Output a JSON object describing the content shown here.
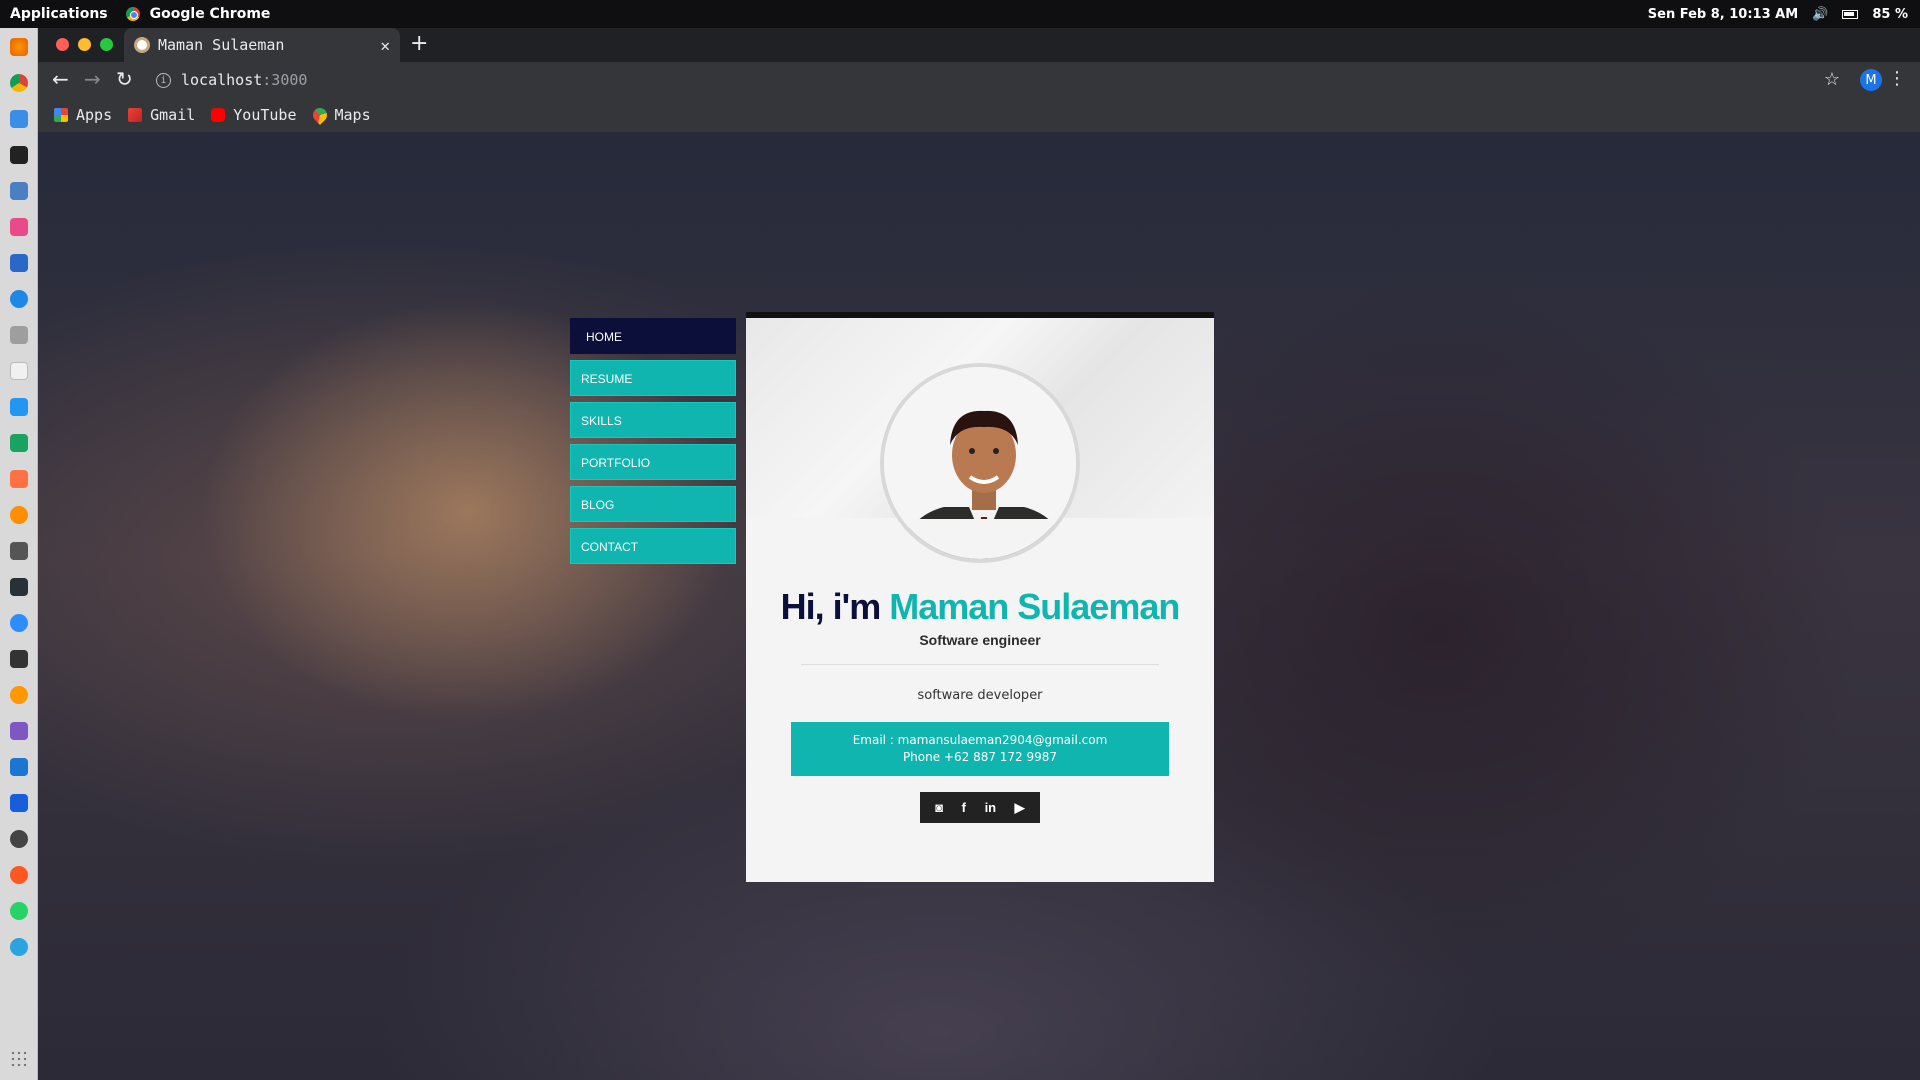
{
  "system_bar": {
    "applications": "Applications",
    "app_name": "Google Chrome",
    "datetime": "Sen Feb  8, 10:13 AM",
    "battery": "85 %"
  },
  "browser": {
    "tab_title": "Maman Sulaeman",
    "url_host": "localhost",
    "url_port": ":3000",
    "profile_initial": "M",
    "bookmarks": [
      {
        "label": "Apps",
        "icon": "apps-grid-icon"
      },
      {
        "label": "Gmail",
        "icon": "gmail-icon"
      },
      {
        "label": "YouTube",
        "icon": "youtube-icon"
      },
      {
        "label": "Maps",
        "icon": "maps-icon"
      }
    ]
  },
  "site": {
    "menu": [
      "HOME",
      "RESUME",
      "SKILLS",
      "PORTFOLIO",
      "BLOG",
      "CONTACT"
    ],
    "active_menu": "HOME",
    "greeting": "Hi, i'm ",
    "name": "Maman Sulaeman",
    "role": "Software engineer",
    "description": "software developer",
    "email_line": "Email : mamansulaeman2904@gmail.com",
    "phone_line": "Phone +62 887 172 9987",
    "social": [
      {
        "icon": "instagram-icon",
        "glyph": "◙"
      },
      {
        "icon": "facebook-icon",
        "glyph": "f"
      },
      {
        "icon": "linkedin-icon",
        "glyph": "in"
      },
      {
        "icon": "youtube-icon",
        "glyph": "▶"
      }
    ],
    "colors": {
      "accent": "#0fb5ae",
      "dark": "#0d0f3b"
    }
  }
}
